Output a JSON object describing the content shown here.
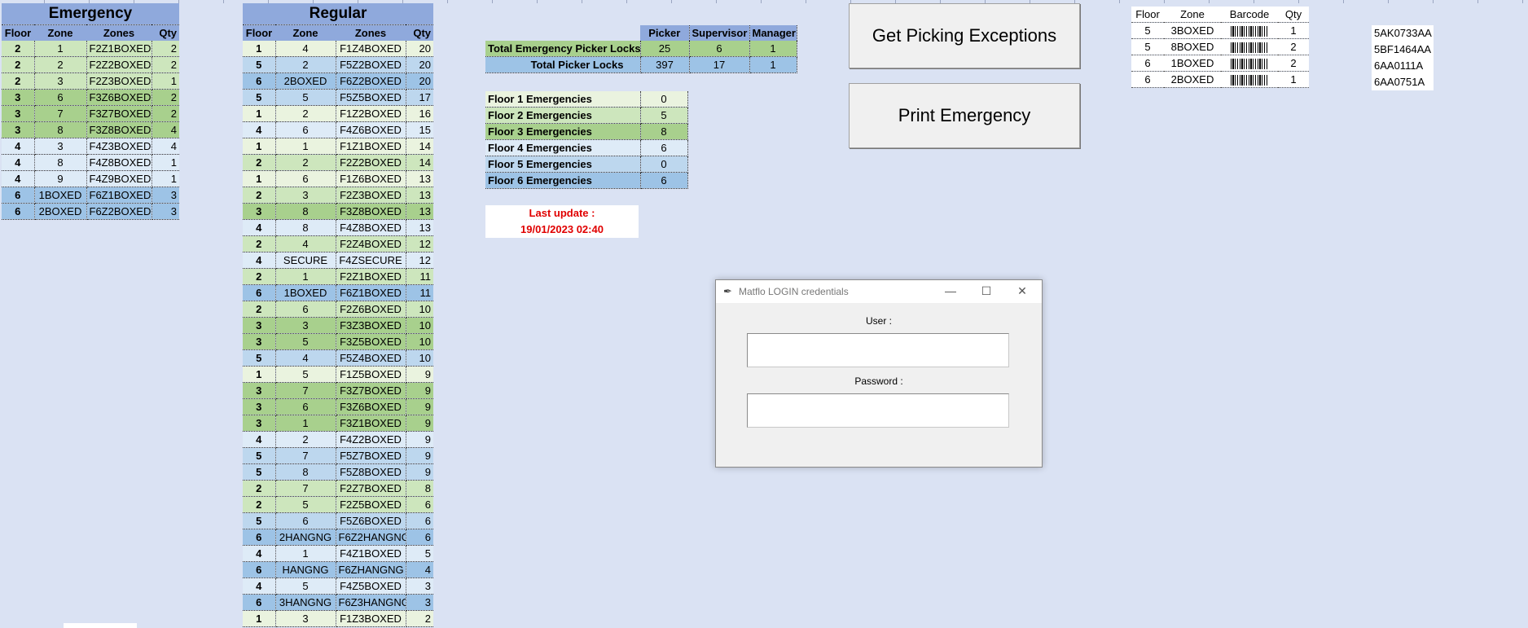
{
  "emergency": {
    "title": "Emergency",
    "headers": [
      "Floor",
      "Zone",
      "Zones",
      "Qty"
    ],
    "rows": [
      {
        "floor": "2",
        "zone": "1",
        "zones": "F2Z1BOXED",
        "qty": "2",
        "f": "f2"
      },
      {
        "floor": "2",
        "zone": "2",
        "zones": "F2Z2BOXED",
        "qty": "2",
        "f": "f2"
      },
      {
        "floor": "2",
        "zone": "3",
        "zones": "F2Z3BOXED",
        "qty": "1",
        "f": "f2"
      },
      {
        "floor": "3",
        "zone": "6",
        "zones": "F3Z6BOXED",
        "qty": "2",
        "f": "f3"
      },
      {
        "floor": "3",
        "zone": "7",
        "zones": "F3Z7BOXED",
        "qty": "2",
        "f": "f3"
      },
      {
        "floor": "3",
        "zone": "8",
        "zones": "F3Z8BOXED",
        "qty": "4",
        "f": "f3"
      },
      {
        "floor": "4",
        "zone": "3",
        "zones": "F4Z3BOXED",
        "qty": "4",
        "f": "f4"
      },
      {
        "floor": "4",
        "zone": "8",
        "zones": "F4Z8BOXED",
        "qty": "1",
        "f": "f4"
      },
      {
        "floor": "4",
        "zone": "9",
        "zones": "F4Z9BOXED",
        "qty": "1",
        "f": "f4"
      },
      {
        "floor": "6",
        "zone": "1BOXED",
        "zones": "F6Z1BOXED",
        "qty": "3",
        "f": "f6"
      },
      {
        "floor": "6",
        "zone": "2BOXED",
        "zones": "F6Z2BOXED",
        "qty": "3",
        "f": "f6"
      }
    ]
  },
  "regular": {
    "title": "Regular",
    "headers": [
      "Floor",
      "Zone",
      "Zones",
      "Qty"
    ],
    "rows": [
      {
        "floor": "1",
        "zone": "4",
        "zones": "F1Z4BOXED",
        "qty": "20",
        "f": "f1"
      },
      {
        "floor": "5",
        "zone": "2",
        "zones": "F5Z2BOXED",
        "qty": "20",
        "f": "f5"
      },
      {
        "floor": "6",
        "zone": "2BOXED",
        "zones": "F6Z2BOXED",
        "qty": "20",
        "f": "f6"
      },
      {
        "floor": "5",
        "zone": "5",
        "zones": "F5Z5BOXED",
        "qty": "17",
        "f": "f5"
      },
      {
        "floor": "1",
        "zone": "2",
        "zones": "F1Z2BOXED",
        "qty": "16",
        "f": "f1"
      },
      {
        "floor": "4",
        "zone": "6",
        "zones": "F4Z6BOXED",
        "qty": "15",
        "f": "f4"
      },
      {
        "floor": "1",
        "zone": "1",
        "zones": "F1Z1BOXED",
        "qty": "14",
        "f": "f1"
      },
      {
        "floor": "2",
        "zone": "2",
        "zones": "F2Z2BOXED",
        "qty": "14",
        "f": "f2"
      },
      {
        "floor": "1",
        "zone": "6",
        "zones": "F1Z6BOXED",
        "qty": "13",
        "f": "f1"
      },
      {
        "floor": "2",
        "zone": "3",
        "zones": "F2Z3BOXED",
        "qty": "13",
        "f": "f2"
      },
      {
        "floor": "3",
        "zone": "8",
        "zones": "F3Z8BOXED",
        "qty": "13",
        "f": "f3"
      },
      {
        "floor": "4",
        "zone": "8",
        "zones": "F4Z8BOXED",
        "qty": "13",
        "f": "f4"
      },
      {
        "floor": "2",
        "zone": "4",
        "zones": "F2Z4BOXED",
        "qty": "12",
        "f": "f2"
      },
      {
        "floor": "4",
        "zone": "SECURE",
        "zones": "F4ZSECURE",
        "qty": "12",
        "f": "f4"
      },
      {
        "floor": "2",
        "zone": "1",
        "zones": "F2Z1BOXED",
        "qty": "11",
        "f": "f2"
      },
      {
        "floor": "6",
        "zone": "1BOXED",
        "zones": "F6Z1BOXED",
        "qty": "11",
        "f": "f6"
      },
      {
        "floor": "2",
        "zone": "6",
        "zones": "F2Z6BOXED",
        "qty": "10",
        "f": "f2"
      },
      {
        "floor": "3",
        "zone": "3",
        "zones": "F3Z3BOXED",
        "qty": "10",
        "f": "f3"
      },
      {
        "floor": "3",
        "zone": "5",
        "zones": "F3Z5BOXED",
        "qty": "10",
        "f": "f3"
      },
      {
        "floor": "5",
        "zone": "4",
        "zones": "F5Z4BOXED",
        "qty": "10",
        "f": "f5"
      },
      {
        "floor": "1",
        "zone": "5",
        "zones": "F1Z5BOXED",
        "qty": "9",
        "f": "f1"
      },
      {
        "floor": "3",
        "zone": "7",
        "zones": "F3Z7BOXED",
        "qty": "9",
        "f": "f3"
      },
      {
        "floor": "3",
        "zone": "6",
        "zones": "F3Z6BOXED",
        "qty": "9",
        "f": "f3"
      },
      {
        "floor": "3",
        "zone": "1",
        "zones": "F3Z1BOXED",
        "qty": "9",
        "f": "f3"
      },
      {
        "floor": "4",
        "zone": "2",
        "zones": "F4Z2BOXED",
        "qty": "9",
        "f": "f4"
      },
      {
        "floor": "5",
        "zone": "7",
        "zones": "F5Z7BOXED",
        "qty": "9",
        "f": "f5"
      },
      {
        "floor": "5",
        "zone": "8",
        "zones": "F5Z8BOXED",
        "qty": "9",
        "f": "f5"
      },
      {
        "floor": "2",
        "zone": "7",
        "zones": "F2Z7BOXED",
        "qty": "8",
        "f": "f2"
      },
      {
        "floor": "2",
        "zone": "5",
        "zones": "F2Z5BOXED",
        "qty": "6",
        "f": "f2"
      },
      {
        "floor": "5",
        "zone": "6",
        "zones": "F5Z6BOXED",
        "qty": "6",
        "f": "f5"
      },
      {
        "floor": "6",
        "zone": "2HANGNG",
        "zones": "F6Z2HANGNG",
        "qty": "6",
        "f": "f6"
      },
      {
        "floor": "4",
        "zone": "1",
        "zones": "F4Z1BOXED",
        "qty": "5",
        "f": "f4"
      },
      {
        "floor": "6",
        "zone": "HANGNG",
        "zones": "F6ZHANGNG",
        "qty": "4",
        "f": "f6"
      },
      {
        "floor": "4",
        "zone": "5",
        "zones": "F4Z5BOXED",
        "qty": "3",
        "f": "f4"
      },
      {
        "floor": "6",
        "zone": "3HANGNG",
        "zones": "F6Z3HANGNG",
        "qty": "3",
        "f": "f6"
      },
      {
        "floor": "1",
        "zone": "3",
        "zones": "F1Z3BOXED",
        "qty": "2",
        "f": "f1"
      }
    ]
  },
  "locks": {
    "headers": [
      "Picker",
      "Supervisor",
      "Manager"
    ],
    "rows": [
      {
        "label": "Total Emergency Picker Locks",
        "picker": "25",
        "supervisor": "6",
        "manager": "1"
      },
      {
        "label": "Total Picker Locks",
        "picker": "397",
        "supervisor": "17",
        "manager": "1"
      }
    ]
  },
  "floor_emergencies": [
    {
      "label": "Floor 1 Emergencies",
      "value": "0",
      "f": "f1"
    },
    {
      "label": "Floor 2 Emergencies",
      "value": "5",
      "f": "f2"
    },
    {
      "label": "Floor 3 Emergencies",
      "value": "8",
      "f": "f3"
    },
    {
      "label": "Floor 4 Emergencies",
      "value": "6",
      "f": "f4"
    },
    {
      "label": "Floor 5 Emergencies",
      "value": "0",
      "f": "f5"
    },
    {
      "label": "Floor 6 Emergencies",
      "value": "6",
      "f": "f6"
    }
  ],
  "last_update": {
    "label": "Last update :",
    "value": "19/01/2023 02:40"
  },
  "buttons": {
    "get_exceptions": "Get Picking Exceptions",
    "print_emergency": "Print Emergency"
  },
  "exceptions": {
    "headers": [
      "Floor",
      "Zone",
      "Barcode",
      "Qty"
    ],
    "rows": [
      {
        "floor": "5",
        "zone": "3BOXED",
        "qty": "1"
      },
      {
        "floor": "5",
        "zone": "8BOXED",
        "qty": "2"
      },
      {
        "floor": "6",
        "zone": "1BOXED",
        "qty": "2"
      },
      {
        "floor": "6",
        "zone": "2BOXED",
        "qty": "1"
      }
    ]
  },
  "codes": [
    "5AK0733AA",
    "5BF1464AA",
    "6AA0111A",
    "6AA0751A"
  ],
  "dialog": {
    "title": "Matflo LOGIN credentials",
    "user_label": "User :",
    "password_label": "Password :",
    "user_value": "",
    "password_value": "",
    "minimize": "—",
    "maximize": "☐",
    "close": "✕"
  }
}
